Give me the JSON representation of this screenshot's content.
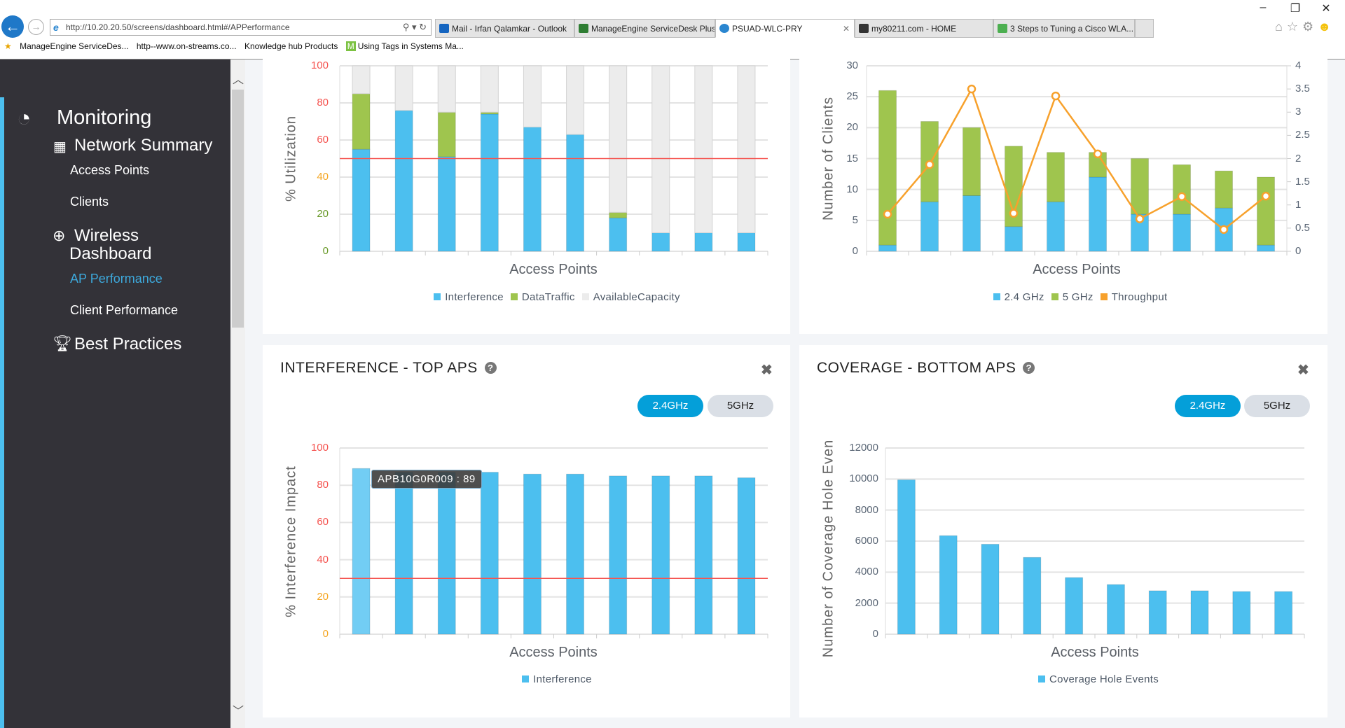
{
  "browser": {
    "address": "http://10.20.20.50/screens/dashboard.html#/APPerformance",
    "tabs": [
      {
        "label": "Mail - Irfan Qalamkar - Outlook",
        "icon": "outlook-icon",
        "color": "#1565c0"
      },
      {
        "label": "ManageEngine ServiceDesk Plus",
        "icon": "manageengine-icon",
        "color": "#2e7d32"
      },
      {
        "label": "PSUAD-WLC-PRY",
        "icon": "ie-icon",
        "color": "#2a86d0",
        "active": true
      },
      {
        "label": "my80211.com - HOME",
        "icon": "site-icon",
        "color": "#333"
      },
      {
        "label": "3 Steps to Tuning a Cisco WLA...",
        "icon": "signal-icon",
        "color": "#4caf50"
      }
    ],
    "favorites": [
      "ManageEngine ServiceDes...",
      "http--www.on-streams.co...",
      "Knowledge hub  Products",
      "Using Tags in Systems Ma..."
    ],
    "window_controls": [
      "–",
      "❐",
      "✕"
    ]
  },
  "sidebar": {
    "monitoring": "Monitoring",
    "network_summary": "Network Summary",
    "access_points": "Access Points",
    "clients": "Clients",
    "wireless": "Wireless",
    "dashboard": "Dashboard",
    "ap_performance": "AP Performance",
    "client_performance": "Client Performance",
    "best_practices": "Best Practices",
    "active_color": "#3da9dc"
  },
  "panels": {
    "interference": {
      "title": "INTERFERENCE - TOP APS",
      "btn_24": "2.4GHz",
      "btn_5": "5GHz",
      "tooltip": "APB10G0R009 : 89"
    },
    "coverage": {
      "title": "COVERAGE - BOTTOM APS",
      "btn_24": "2.4GHz",
      "btn_5": "5GHz"
    },
    "close": "✖",
    "help": "?"
  },
  "chart_data": [
    {
      "type": "bar",
      "stacked": true,
      "xlabel": "Access Points",
      "ylabel": "% Utilization",
      "ylim": [
        0,
        100
      ],
      "yticks": [
        "0",
        "20",
        "40",
        "60",
        "80",
        "100"
      ],
      "ytick_colors": [
        "#6a9a2a",
        "#6a9a2a",
        "#f5a623",
        "#f5534f",
        "#f5534f",
        "#f5534f"
      ],
      "threshold": 50,
      "threshold_color": "#f5534f",
      "series": [
        {
          "name": "Interference",
          "color": "#4cbfef",
          "values": [
            55,
            76,
            51,
            74,
            67,
            63,
            18,
            10,
            10,
            10
          ]
        },
        {
          "name": "DataTraffic",
          "color": "#9fc54e",
          "values": [
            30,
            0,
            24,
            1,
            0,
            0,
            3,
            0,
            0,
            0
          ]
        },
        {
          "name": "AvailableCapacity",
          "color": "#ececec",
          "values": [
            15,
            24,
            25,
            25,
            33,
            37,
            79,
            90,
            90,
            90
          ]
        }
      ]
    },
    {
      "type": "bar",
      "stacked": true,
      "xlabel": "Access Points",
      "ylabel": "Number of Clients",
      "ylim": [
        0,
        30
      ],
      "yticks": [
        "0",
        "5",
        "10",
        "15",
        "20",
        "25",
        "30"
      ],
      "y2lim": [
        0,
        4
      ],
      "y2ticks": [
        "0",
        "0.5",
        "1",
        "1.5",
        "2",
        "2.5",
        "3",
        "3.5",
        "4"
      ],
      "series": [
        {
          "name": "2.4 GHz",
          "color": "#4cbfef",
          "values": [
            1,
            8,
            9,
            4,
            8,
            12,
            6,
            6,
            7,
            1
          ]
        },
        {
          "name": "5 GHz",
          "color": "#9fc54e",
          "values": [
            25,
            13,
            11,
            13,
            8,
            4,
            9,
            8,
            6,
            11
          ]
        },
        {
          "name": "Throughput",
          "color": "#f7a12c",
          "type": "line",
          "axis": "right",
          "values": [
            0.8,
            1.87,
            3.5,
            0.82,
            3.35,
            2.1,
            0.7,
            1.18,
            0.47,
            1.19
          ]
        }
      ]
    },
    {
      "type": "bar",
      "xlabel": "Access Points",
      "ylabel": "% Interference Impact",
      "ylim": [
        0,
        100
      ],
      "yticks": [
        "0",
        "20",
        "40",
        "60",
        "80",
        "100"
      ],
      "ytick_colors": [
        "#f5a623",
        "#f5a623",
        "#f5534f",
        "#f5534f",
        "#f5534f",
        "#f5534f"
      ],
      "threshold": 30,
      "threshold_color": "#f5534f",
      "series": [
        {
          "name": "Interference",
          "color": "#4cbfef",
          "values": [
            89,
            87,
            87,
            87,
            86,
            86,
            85,
            85,
            85,
            84
          ]
        }
      ]
    },
    {
      "type": "bar",
      "xlabel": "Access Points",
      "ylabel": "Number of Coverage Hole Even",
      "ylim": [
        0,
        12000
      ],
      "yticks": [
        "0",
        "2000",
        "4000",
        "6000",
        "8000",
        "10000",
        "12000"
      ],
      "series": [
        {
          "name": "Coverage Hole Events",
          "color": "#4cbfef",
          "values": [
            9950,
            6350,
            5800,
            4950,
            3650,
            3200,
            2800,
            2800,
            2750,
            2750
          ]
        }
      ]
    }
  ]
}
